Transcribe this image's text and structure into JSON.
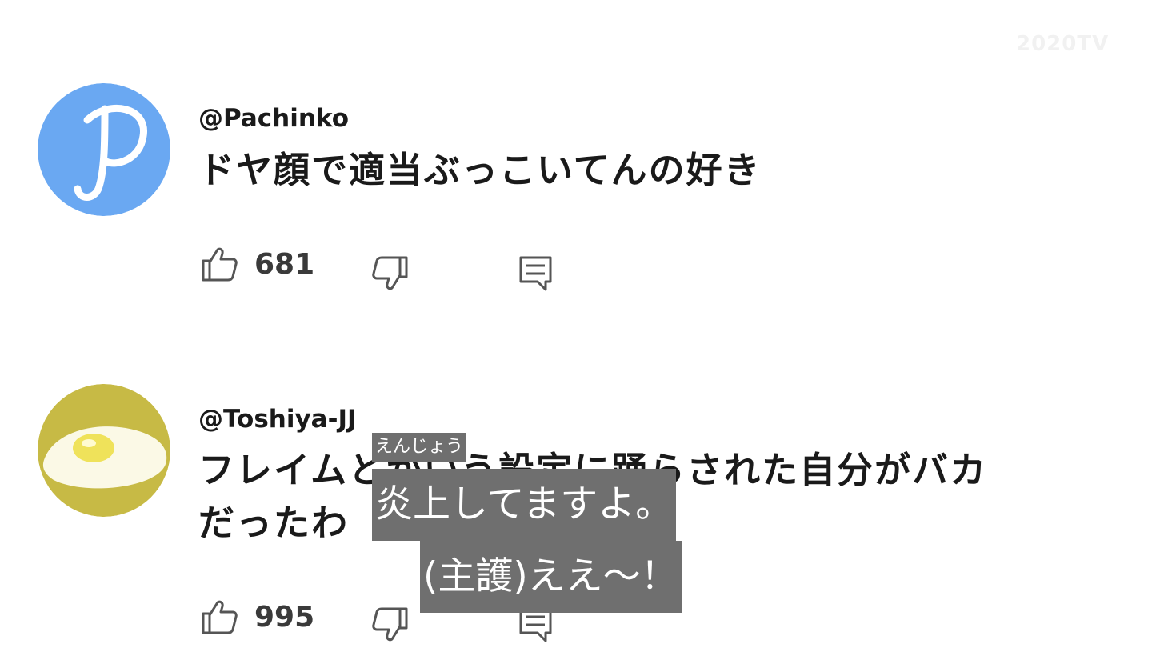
{
  "watermark": "2020TV",
  "comments": [
    {
      "handle": "@Pachinko",
      "avatar_letter": "P",
      "avatar_color": "#6aa8f2",
      "text_lines": [
        "ドヤ顔で適当ぶっこいてんの好き"
      ],
      "likes": "681"
    },
    {
      "handle": "@Toshiya-JJ",
      "avatar_color": "#c7ba45",
      "text_lines": [
        "フレイムとかいう設定に踊らされた自分がバカ",
        "だったわ"
      ],
      "likes": "995"
    }
  ],
  "subtitles": {
    "ruby": "えんじょう",
    "line1": "炎上してますよ。",
    "line2": "(主護)ええ～！"
  },
  "colors": {
    "text": "#1a1a1a",
    "icon": "#555555",
    "subtitle_bg": "#6f6f6f",
    "subtitle_text": "#ffffff"
  }
}
